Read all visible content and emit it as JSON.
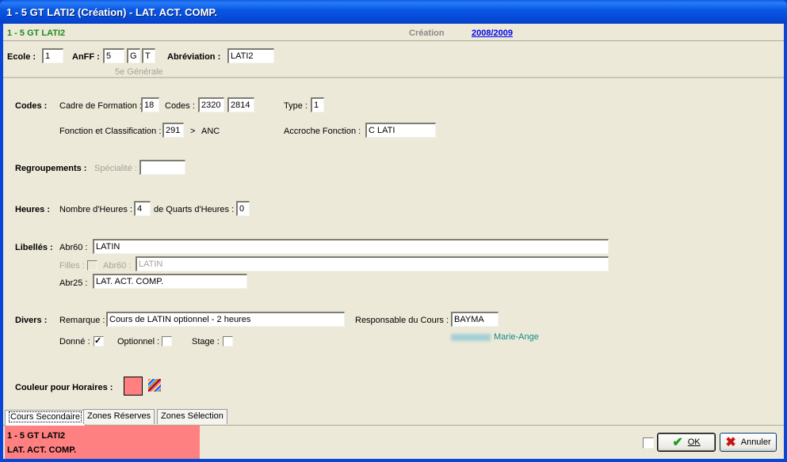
{
  "window": {
    "title": "1 - 5 GT  LATI2 (Création) - LAT. ACT. COMP."
  },
  "header": {
    "course": "1 - 5 GT  LATI2",
    "mode": "Création",
    "year_link": "2008/2009"
  },
  "identity": {
    "ecole_label": "Ecole :",
    "ecole_value": "1",
    "anff_label": "AnFF :",
    "anff_values": [
      "5",
      "G",
      "T"
    ],
    "anff_hint": "5e Générale",
    "abrev_label": "Abréviation :",
    "abrev_value": "LATI2"
  },
  "codes": {
    "section_label": "Codes :",
    "cadre_label": "Cadre de Formation :",
    "cadre_value": "18",
    "codes_label": "Codes :",
    "codes_values": [
      "2320",
      "2814"
    ],
    "type_label": "Type :",
    "type_value": "1",
    "fonction_label": "Fonction et Classification :",
    "fonction_value": "291",
    "fonction_arrow": ">",
    "fonction_text": "ANC",
    "accroche_label": "Accroche Fonction :",
    "accroche_value": "C LATI"
  },
  "regroupements": {
    "section_label": "Regroupements :",
    "specialite_label": "Spécialité :",
    "specialite_value": ""
  },
  "heures": {
    "section_label": "Heures :",
    "nombre_label": "Nombre d'Heures :",
    "nombre_value": "4",
    "quarts_label": "de Quarts d'Heures :",
    "quarts_value": "0"
  },
  "libelles": {
    "section_label": "Libellés :",
    "abr60_label": "Abr60 :",
    "abr60_value": "LATIN",
    "filles_label": "Filles :",
    "filles_checked": false,
    "filles_abr60_label": "Abr60 :",
    "filles_abr60_value": "LATIN",
    "abr25_label": "Abr25 :",
    "abr25_value": "LAT. ACT. COMP."
  },
  "divers": {
    "section_label": "Divers :",
    "remarque_label": "Remarque :",
    "remarque_value": "Cours de LATIN optionnel - 2 heures",
    "responsable_label": "Responsable du Cours :",
    "responsable_value": "BAYMA",
    "responsable_name": "Marie-Ange",
    "donne_label": "Donné :",
    "donne_checked": true,
    "optionnel_label": "Optionnel :",
    "optionnel_checked": false,
    "stage_label": "Stage :",
    "stage_checked": false
  },
  "couleur": {
    "label": "Couleur pour Horaires :",
    "color": "#ff8080",
    "palette_icon": "color-palette-icon"
  },
  "tabs": [
    {
      "label": "Cours Secondaire",
      "active": true
    },
    {
      "label": "Zones Réserves",
      "active": false
    },
    {
      "label": "Zones Sélection",
      "active": false
    }
  ],
  "preview": {
    "line1": "1 - 5 GT  LATI2",
    "line2": "LAT. ACT. COMP.",
    "color": "#ff8080"
  },
  "footer": {
    "ok_label": "OK",
    "cancel_label": "Annuler",
    "ok_icon": "checkmark-icon",
    "cancel_icon": "x-icon"
  }
}
